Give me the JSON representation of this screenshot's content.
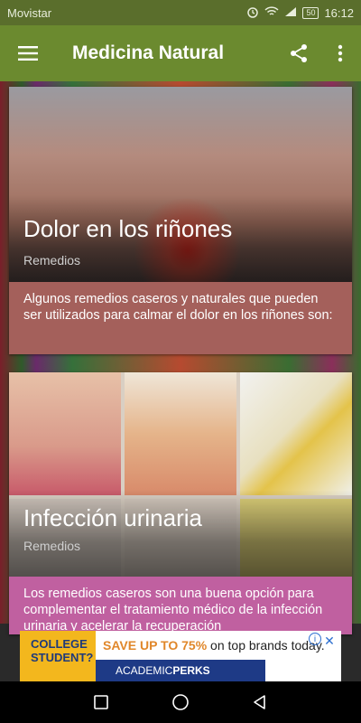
{
  "status": {
    "carrier": "Movistar",
    "battery": "50",
    "time": "16:12"
  },
  "appbar": {
    "title": "Medicina Natural",
    "menu_icon": "hamburger-icon",
    "share_icon": "share-icon",
    "more_icon": "more-vert-icon"
  },
  "cards": [
    {
      "title": "Dolor en los riñones",
      "category": "Remedios",
      "description": "Algunos remedios caseros y naturales que pueden ser utilizados para calmar el dolor en los riñones son:",
      "accent": "#a4605b"
    },
    {
      "title": "Infección urinaria",
      "category": "Remedios",
      "description": "Los remedios caseros son una buena opción para complementar el tratamiento médico de la infección urinaria y acelerar la recuperación",
      "accent": "#c060a0"
    }
  ],
  "ad": {
    "left_text_1": "COLLEGE",
    "left_text_2": "STUDENT?",
    "headline_prefix": "SAVE UP TO 75%",
    "headline_suffix": " on top brands today.",
    "brand_1": "ACADEMIC",
    "brand_2": "PERKS",
    "info_icon": "info-icon",
    "close_icon": "close-icon"
  },
  "navbar": {
    "back_icon": "back-triangle-icon",
    "home_icon": "home-circle-icon",
    "recents_icon": "recents-square-icon"
  }
}
